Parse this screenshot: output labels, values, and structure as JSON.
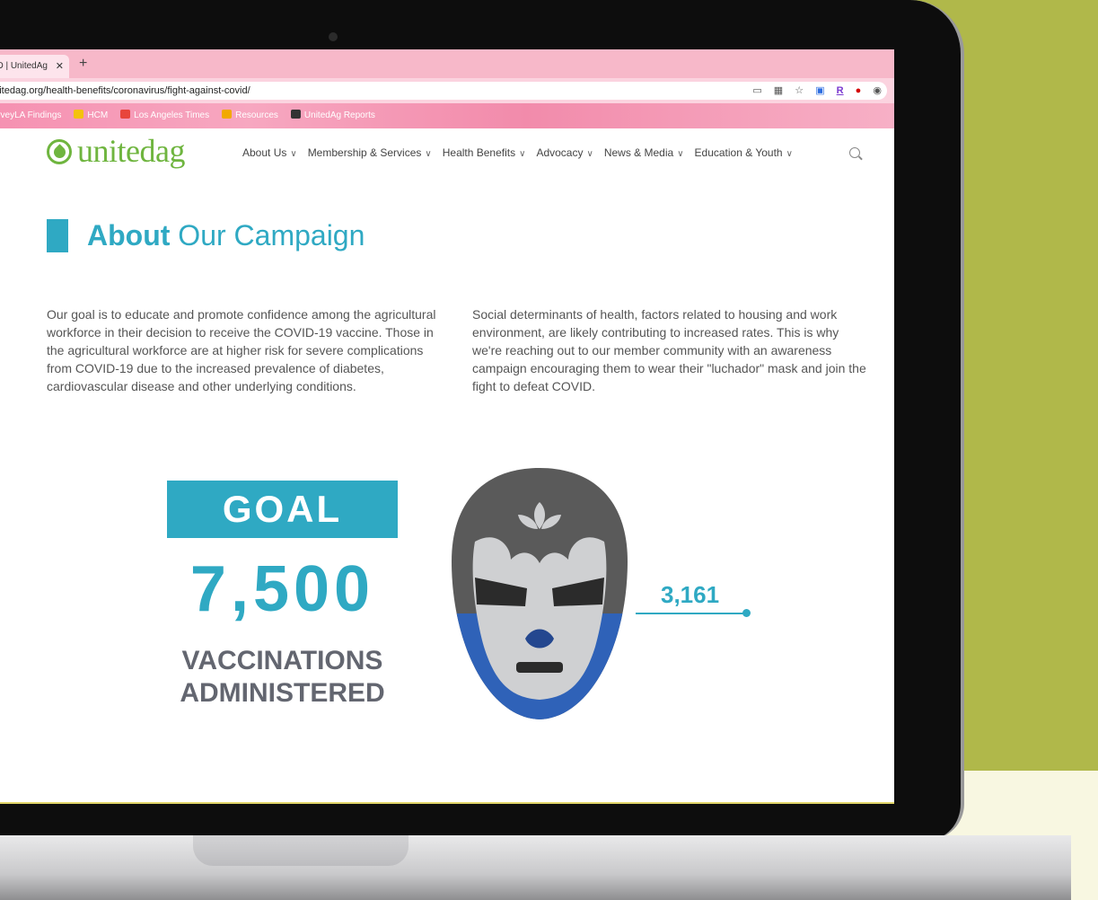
{
  "browser": {
    "tab_title": "COVID | UnitedAg",
    "tab_close": "✕",
    "new_tab": "+",
    "url": "unitedag.org/health-benefits/coronavirus/fight-against-covid/",
    "bookmarks": [
      {
        "label": "SurveyLA Findings",
        "color": "#e84c3d"
      },
      {
        "label": "HCM",
        "color": "#f4c20d"
      },
      {
        "label": "Los Angeles Times",
        "color": "#e8453c"
      },
      {
        "label": "Resources",
        "color": "#f2a900"
      },
      {
        "label": "UnitedAg Reports",
        "color": "#333333"
      }
    ],
    "ext_r": "R"
  },
  "site": {
    "logo_text": "unitedag",
    "nav": [
      {
        "label": "About Us"
      },
      {
        "label": "Membership & Services"
      },
      {
        "label": "Health Benefits"
      },
      {
        "label": "Advocacy"
      },
      {
        "label": "News & Media"
      },
      {
        "label": "Education & Youth"
      }
    ],
    "chevron": "∨"
  },
  "content": {
    "title_bold": "About",
    "title_rest": " Our Campaign",
    "para_left": "Our goal is to educate and promote confidence among the agricultural workforce in their decision to receive the COVID-19 vaccine. Those in the agricultural workforce are at higher risk for severe complications from COVID-19 due to the increased prevalence of diabetes, cardiovascular disease and other underlying conditions.",
    "para_right": "Social determinants of health, factors related to housing and work environment, are likely contributing to increased rates. This is why we're reaching out to our member community with an awareness campaign encouraging them to wear their \"luchador\" mask and join the fight to defeat COVID.",
    "goal_label": "GOAL",
    "goal_number": "7,500",
    "goal_caption_1": "VACCINATIONS",
    "goal_caption_2": "ADMINISTERED",
    "progress_value": "3,161",
    "progress_fraction": 0.4215
  },
  "colors": {
    "brand_green": "#6fb53f",
    "accent_teal": "#2fa9c3",
    "mask_gray": "#5a5a5a",
    "mask_light": "#cfd0d2",
    "mask_blue": "#2f62b8"
  }
}
